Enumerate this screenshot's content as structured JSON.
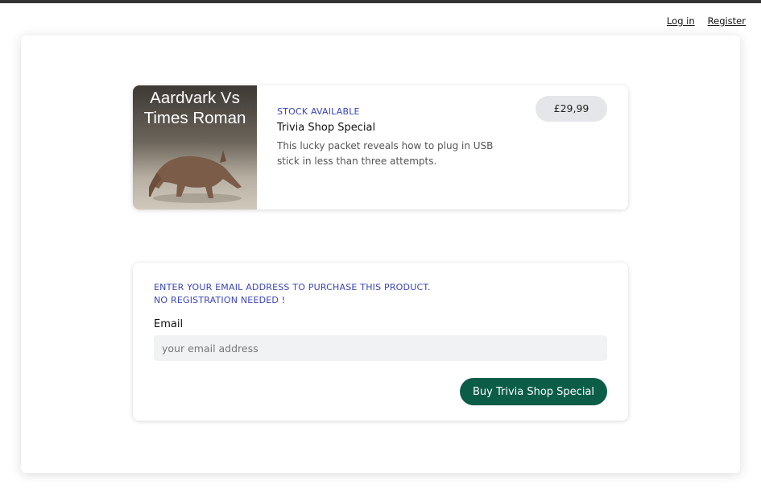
{
  "header": {
    "login_label": "Log in",
    "register_label": "Register"
  },
  "product": {
    "image_text_line1": "Aardvark Vs",
    "image_text_line2": "Times Roman",
    "stock_status": "STOCK AVAILABLE",
    "name": "Trivia Shop Special",
    "description": "This lucky packet reveals how to plug in USB stick in less than three attempts.",
    "price": "£29,99"
  },
  "purchase": {
    "instruction_line1": "ENTER YOUR EMAIL ADDRESS TO PURCHASE THIS PRODUCT.",
    "instruction_line2": "NO REGISTRATION NEEDED !",
    "email_label": "Email",
    "email_placeholder": "your email address",
    "email_value": "",
    "buy_label": "Buy Trivia Shop Special"
  },
  "colors": {
    "accent_text": "#3b45b5",
    "buy_button": "#0b5d48",
    "price_badge": "#e5e6ea",
    "input_background": "#f1f2f4"
  }
}
